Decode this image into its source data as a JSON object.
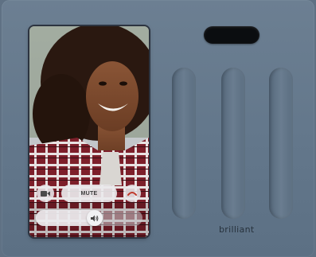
{
  "device": {
    "brand": "brilliant",
    "body_color": "#677a8e",
    "sensor_color": "#0b0d10",
    "slider_count": 3
  },
  "call_screen": {
    "mute_label": "MUTE",
    "camera_button_icon": "video-camera-icon",
    "hangup_button_icon": "phone-hangup-icon",
    "volume_icon": "speaker-icon",
    "hangup_color": "#c0392b",
    "volume_level": 0.56
  }
}
